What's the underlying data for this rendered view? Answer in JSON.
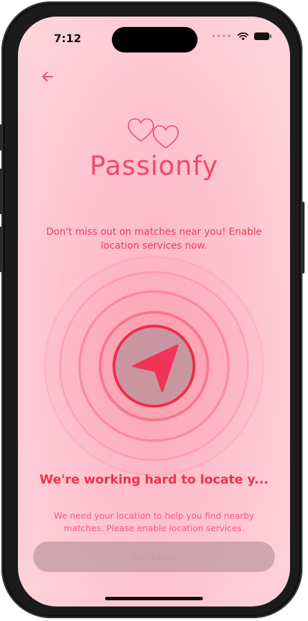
{
  "status_bar": {
    "time": "7:12",
    "dots": "••••"
  },
  "icons": {
    "back": "arrow-left-icon",
    "logo": "double-heart-icon",
    "locate": "location-arrow-icon",
    "wifi": "wifi-icon",
    "battery": "battery-icon"
  },
  "brand": {
    "name": "Passionfy"
  },
  "intro": {
    "text": "Don't miss out on matches near you! Enable location services now."
  },
  "status": {
    "headline": "We're working hard to locate y...",
    "description": "We need your location to help you find nearby matches. Please enable location services."
  },
  "actions": {
    "continue_label": "Continue",
    "continue_enabled": false
  },
  "colors": {
    "accent": "#f0304f",
    "brand": "#f0496b",
    "background": "#fdc3cf"
  }
}
